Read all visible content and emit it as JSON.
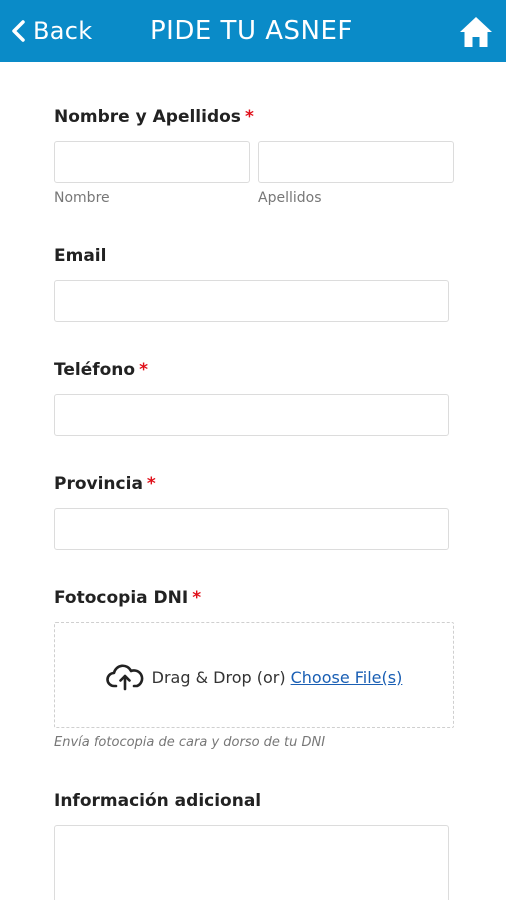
{
  "header": {
    "back_label": "Back",
    "title": "PIDE TU ASNEF",
    "bg_color": "#0a8bc8"
  },
  "form": {
    "required_marker": "*",
    "name": {
      "label": "Nombre y Apellidos",
      "first_sublabel": "Nombre",
      "last_sublabel": "Apellidos",
      "first_value": "",
      "last_value": ""
    },
    "email": {
      "label": "Email",
      "value": ""
    },
    "phone": {
      "label": "Teléfono",
      "value": ""
    },
    "province": {
      "label": "Provincia",
      "value": ""
    },
    "dni": {
      "label": "Fotocopia DNI",
      "drop_text": "Drag & Drop (or)",
      "choose_link": "Choose File(s)",
      "hint": "Envía fotocopia de cara y dorso de tu DNI"
    },
    "additional": {
      "label": "Información adicional",
      "value": ""
    }
  },
  "icons": {
    "back": "chevron-left-icon",
    "home": "home-icon",
    "upload": "cloud-upload-icon"
  },
  "colors": {
    "required": "#e0101a",
    "link": "#1a5fb4"
  }
}
